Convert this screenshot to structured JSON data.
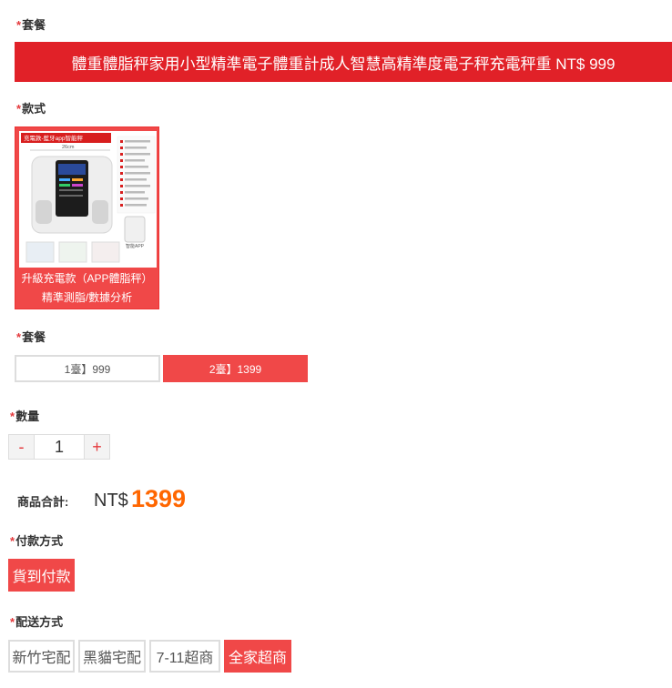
{
  "sections": {
    "package": {
      "star": "*",
      "label": "套餐"
    },
    "style": {
      "star": "*",
      "label": "款式"
    },
    "package2": {
      "star": "*",
      "label": "套餐"
    },
    "quantity": {
      "star": "*",
      "label": "數量"
    },
    "payment": {
      "star": "*",
      "label": "付款方式"
    },
    "shipping": {
      "star": "*",
      "label": "配送方式"
    }
  },
  "package_banner": "體重體脂秤家用小型精準電子體重計成人智慧高精準度電子秤充電秤重 NT$ 999",
  "style_option": {
    "image_badge": "充電款-藍牙app智能秤",
    "image_size": "26cm",
    "image_app_label": "智能APP",
    "caption_line1": "升級充電款（APP體脂秤）",
    "caption_line2": "精準測脂/數據分析",
    "selected": true
  },
  "package_options": [
    {
      "label": "1臺】999",
      "selected": false
    },
    {
      "label": "2臺】1399",
      "selected": true
    }
  ],
  "quantity": {
    "minus": "-",
    "value": "1",
    "plus": "+"
  },
  "total": {
    "label": "商品合計:",
    "prefix": "NT$",
    "value": "1399"
  },
  "payment_options": [
    {
      "label": "貨到付款",
      "selected": true
    }
  ],
  "shipping_options": [
    {
      "label": "新竹宅配",
      "selected": false
    },
    {
      "label": "黑貓宅配",
      "selected": false
    },
    {
      "label": "7-11超商",
      "selected": false
    },
    {
      "label": "全家超商",
      "selected": true
    }
  ],
  "colors": {
    "accent": "#f04848",
    "banner": "#e12128",
    "price": "#ff6600",
    "required_star": "#e4393c"
  }
}
